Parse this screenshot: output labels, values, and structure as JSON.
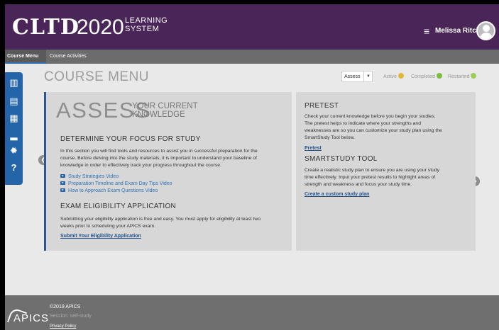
{
  "header": {
    "logo_main": "CLTD",
    "logo_year": "2020",
    "logo_system_line1": "LEARNING",
    "logo_system_line2": "SYSTEM",
    "menu_icon": "≡",
    "user_name": "Melissa Ritchie"
  },
  "nav": {
    "tabs": [
      {
        "label": "Course Menu",
        "active": true
      },
      {
        "label": "Course Activities",
        "active": false
      }
    ]
  },
  "toolbar": {
    "items": [
      {
        "icon": "library-icon",
        "glyph": "▥"
      },
      {
        "icon": "notes-icon",
        "glyph": "▤"
      },
      {
        "icon": "flashcards-icon",
        "glyph": "▦"
      },
      {
        "icon": "chart-icon",
        "glyph": "▂"
      },
      {
        "icon": "badge-icon",
        "glyph": "✹"
      },
      {
        "icon": "help-icon",
        "glyph": "?"
      }
    ]
  },
  "page": {
    "title": "COURSE MENU",
    "filter_value": "Assess",
    "filter_caret": "▼",
    "legend": {
      "active": "Active",
      "completed": "Completed",
      "restarted": "Restarted"
    },
    "legend_colors": {
      "active": "#e1b93a",
      "completed": "#7bbf3d",
      "restarted": "#9bcf52"
    }
  },
  "assess": {
    "big_title": "ASSESS",
    "small_title_line1": "YOUR CURRENT",
    "small_title_line2": "KNOWLEDGE",
    "focus_heading": "DETERMINE YOUR FOCUS FOR STUDY",
    "focus_line1": "In this section you will find tools and resources to assist you in successful preparation for the",
    "focus_line2": "course. Before delving into the study materials, it is important to understand your baseline of",
    "focus_line3": "knowledge in order to effectively track your progress throughout the course.",
    "videos": [
      "Study Strategies Video",
      "Preparation Timeline and Exam Day Tips Video",
      "How to Approach Exam Questions Video"
    ],
    "eligibility_heading": "EXAM ELIGIBILITY APPLICATION",
    "eligibility_line1": "Submitting your eligibility application is free and easy. You must apply for eligibility at least two",
    "eligibility_line2": "weeks prior to scheduling your APICS exam.",
    "eligibility_link": "Submit Your Eligibility Application"
  },
  "pretest": {
    "heading": "PRETEST",
    "line1": "Check your current knowledge before you begin your studies.",
    "line2": "The pretest helps to indicate where your strengths and",
    "line3": "weaknesses are so you can customize your study plan using the",
    "line4": "SmartStudy Tool below.",
    "link": "Pretest"
  },
  "smartstudy": {
    "heading": "SMARTSTUDY TOOL",
    "line1": "Create a realistic study plan to ensure you are using your study",
    "line2": "time effectively. Input your pretest results to highlight areas of",
    "line3": "strength and weakness and focus your study time.",
    "link": "Create a custom study plan"
  },
  "carousel": {
    "prev_glyph": "❮",
    "next_glyph": "❯"
  },
  "footer": {
    "logo": "APICS",
    "copyright": "©2019 APICS",
    "session": "Session: self-study",
    "privacy": "Privacy Policy"
  }
}
